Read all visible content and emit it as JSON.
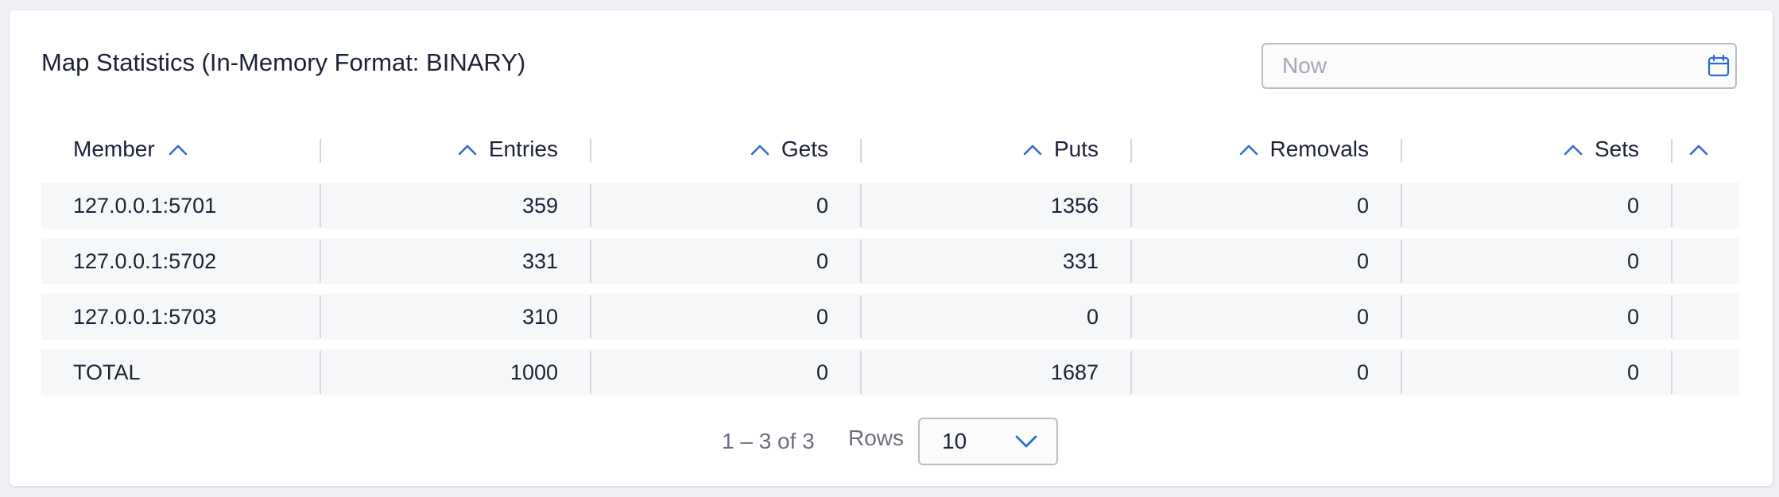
{
  "title": "Map Statistics (In-Memory Format: BINARY)",
  "date_picker": {
    "placeholder": "Now",
    "value": ""
  },
  "icons": {
    "calendar": "calendar-icon",
    "sort": "chevron-up-icon",
    "rows_dropdown": "chevron-down-icon"
  },
  "colors": {
    "accent": "#2d6ccf",
    "text": "#1c2136",
    "muted": "#6b6f7d",
    "row_bg": "#f6f7f8"
  },
  "table": {
    "columns": [
      "Member",
      "Entries",
      "Gets",
      "Puts",
      "Removals",
      "Sets"
    ],
    "rows": [
      [
        "127.0.0.1:5701",
        "359",
        "0",
        "1356",
        "0",
        "0"
      ],
      [
        "127.0.0.1:5702",
        "331",
        "0",
        "331",
        "0",
        "0"
      ],
      [
        "127.0.0.1:5703",
        "310",
        "0",
        "0",
        "0",
        "0"
      ],
      [
        "TOTAL",
        "1000",
        "0",
        "1687",
        "0",
        "0"
      ]
    ]
  },
  "pagination": {
    "range_label": "1 – 3 of 3",
    "rows_label": "Rows",
    "rows_per_page": "10"
  }
}
